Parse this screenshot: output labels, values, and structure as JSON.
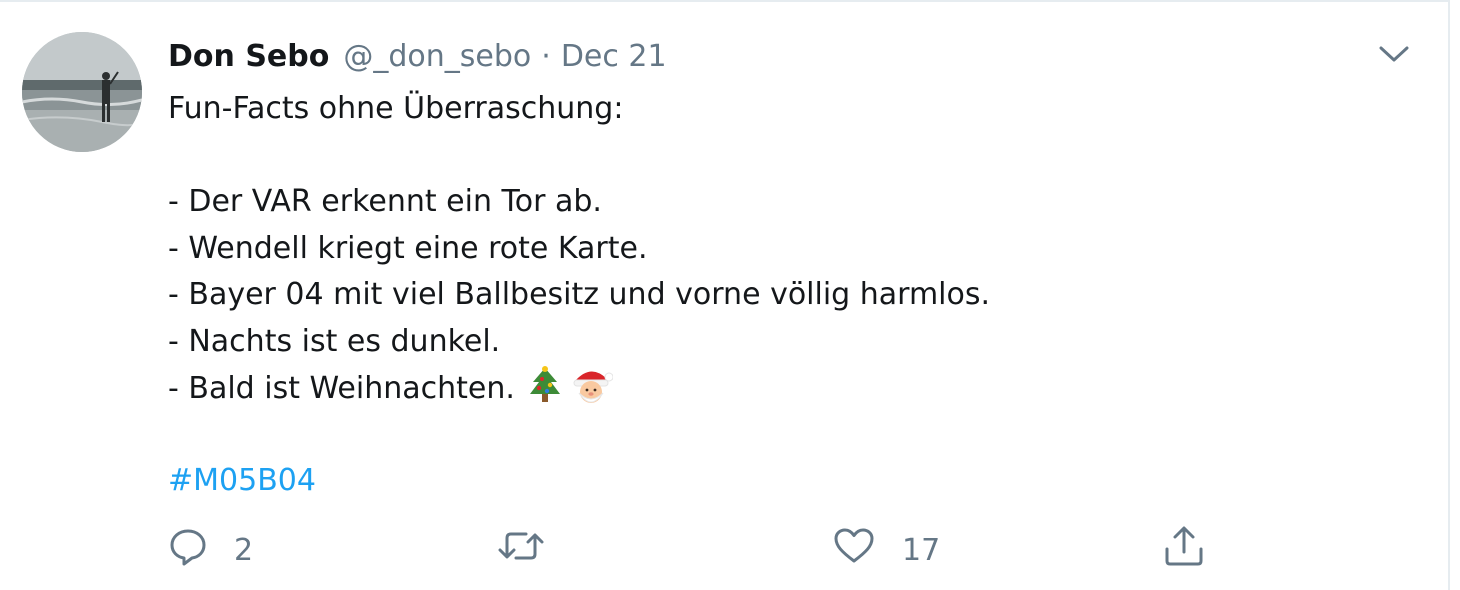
{
  "tweet": {
    "display_name": "Don Sebo",
    "handle": "@_don_sebo",
    "separator": "·",
    "date": "Dec 21",
    "lines": [
      "Fun-Facts ohne Überraschung:",
      "",
      "- Der VAR erkennt ein Tor ab.",
      "- Wendell kriegt eine rote Karte.",
      "- Bayer 04 mit viel Ballbesitz und vorne völlig harmlos.",
      "- Nachts ist es dunkel.",
      "- Bald ist Weihnachten.",
      "",
      ""
    ],
    "emojis": [
      "christmas-tree-icon",
      "santa-claus-icon"
    ],
    "hashtag": "#M05B04",
    "actions": {
      "reply": {
        "icon": "reply-icon",
        "count": "2"
      },
      "retweet": {
        "icon": "retweet-icon",
        "count": ""
      },
      "like": {
        "icon": "heart-icon",
        "count": "17"
      },
      "share": {
        "icon": "share-icon",
        "count": ""
      }
    }
  },
  "colors": {
    "text": "#14171a",
    "muted": "#657786",
    "link": "#1da1f2",
    "border": "#e6ecf0"
  }
}
